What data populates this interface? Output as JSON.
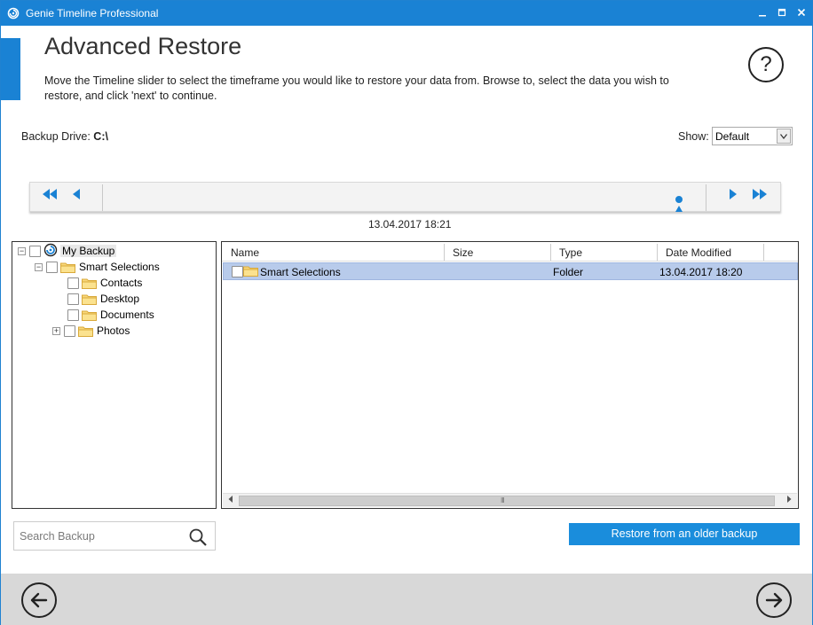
{
  "window": {
    "title": "Genie Timeline Professional",
    "minimize_icon": "minimize-icon",
    "maximize_icon": "maximize-icon",
    "close_icon": "close-icon"
  },
  "header": {
    "title": "Advanced Restore",
    "description": "Move the Timeline slider to select the timeframe you would like to restore your data from. Browse to, select the data you wish to restore, and click 'next' to continue.",
    "help_label": "?"
  },
  "backup_drive": {
    "label": "Backup Drive:",
    "value": "C:\\"
  },
  "show": {
    "label": "Show:",
    "selected": "Default"
  },
  "timeline": {
    "date": "13.04.2017 18:21",
    "buttons": [
      "rewind-icon",
      "step-back-icon",
      "step-forward-icon",
      "fast-forward-icon"
    ]
  },
  "tree": {
    "items": [
      {
        "label": "My Backup",
        "level": 0,
        "expander": "−"
      },
      {
        "label": "Smart Selections",
        "level": 1,
        "expander": "−"
      },
      {
        "label": "Contacts",
        "level": 2,
        "expander": ""
      },
      {
        "label": "Desktop",
        "level": 2,
        "expander": ""
      },
      {
        "label": "Documents",
        "level": 2,
        "expander": ""
      },
      {
        "label": "Photos",
        "level": 2,
        "expander": "+"
      }
    ]
  },
  "files": {
    "columns": [
      "Name",
      "Size",
      "Type",
      "Date Modified"
    ],
    "rows": [
      {
        "name": "Smart Selections",
        "size": "",
        "type": "Folder",
        "date_modified": "13.04.2017 18:20"
      }
    ],
    "scroll_grip": "III"
  },
  "search": {
    "placeholder": "Search Backup"
  },
  "actions": {
    "restore_older_label": "Restore from an older backup"
  },
  "colors": {
    "accent": "#1a82d4",
    "selection": "#b8cbeb",
    "footer": "#d8d8d8"
  }
}
